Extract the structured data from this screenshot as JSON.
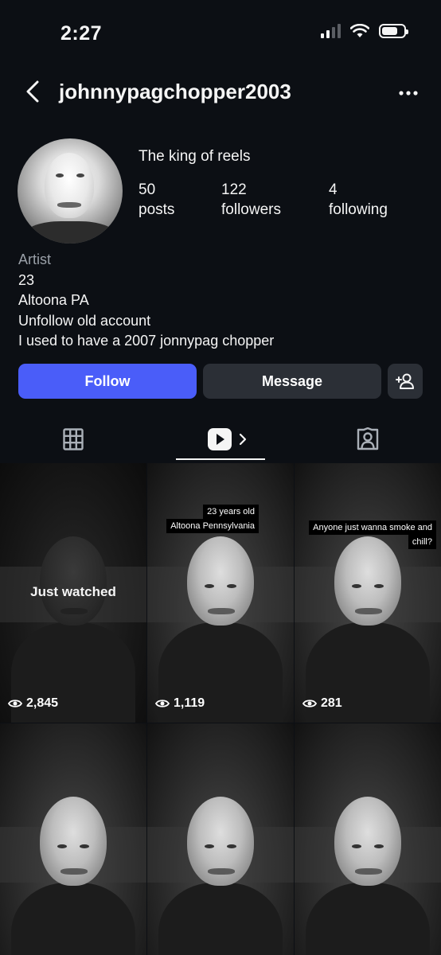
{
  "status_bar": {
    "time": "2:27"
  },
  "header": {
    "username": "johnnypagchopper2003"
  },
  "profile": {
    "display_name": "The king of reels",
    "stats": [
      {
        "value": "50",
        "label": "posts"
      },
      {
        "value": "122",
        "label": "followers"
      },
      {
        "value": "4",
        "label": "following"
      }
    ],
    "bio": {
      "category": "Artist",
      "lines": [
        "23",
        "Altoona PA",
        "Unfollow old account",
        "I used to have a 2007 jonnypag chopper"
      ]
    }
  },
  "actions": {
    "follow": "Follow",
    "message": "Message"
  },
  "grid": {
    "reels": [
      {
        "views": "2,845",
        "overlay": "Just watched"
      },
      {
        "views": "1,119",
        "caption_lines": [
          "23 years old",
          "Altoona Pennsylvania"
        ]
      },
      {
        "views": "281",
        "caption_lines": [
          "Anyone just wanna smoke and",
          "chill?"
        ]
      }
    ]
  },
  "colors": {
    "background": "#0c0f14",
    "accent": "#4a5df9",
    "button_secondary": "#2b2f36"
  }
}
